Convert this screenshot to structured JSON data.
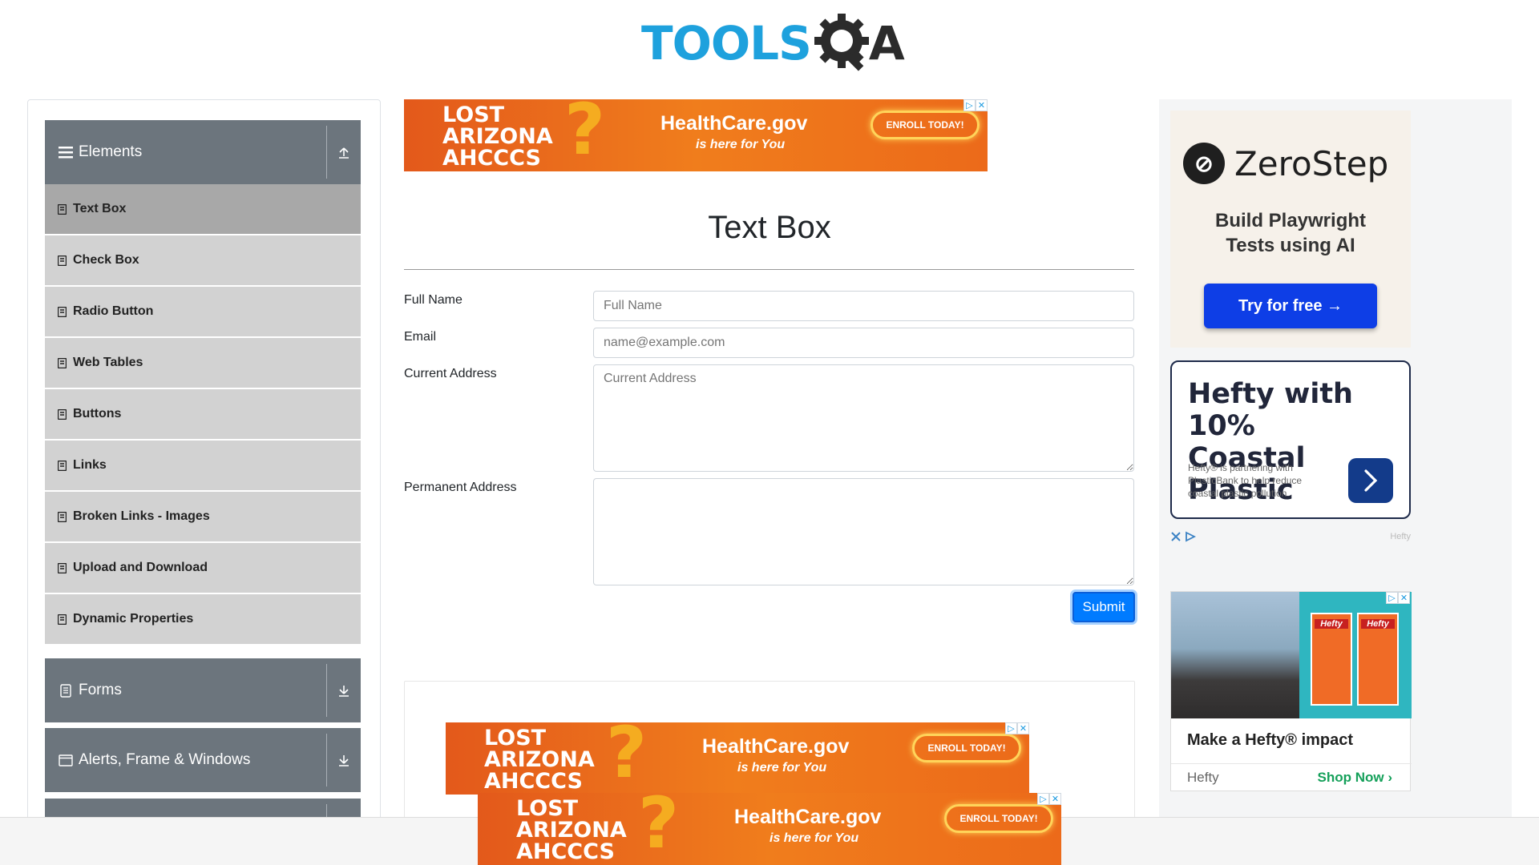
{
  "header": {
    "logo_part1": "TOOLS",
    "logo_part2": "A",
    "logo_alt": "ToolsQA"
  },
  "sidebar": {
    "groups": [
      {
        "label": "Elements",
        "icon": "hamburger-icon",
        "toggle_icon": "collapse-up-icon",
        "expanded": true
      },
      {
        "label": "Forms",
        "icon": "document-icon",
        "toggle_icon": "expand-down-icon",
        "expanded": false
      },
      {
        "label": "Alerts, Frame & Windows",
        "icon": "window-icon",
        "toggle_icon": "expand-down-icon",
        "expanded": false
      }
    ],
    "items": [
      {
        "label": "Text Box",
        "active": true
      },
      {
        "label": "Check Box",
        "active": false
      },
      {
        "label": "Radio Button",
        "active": false
      },
      {
        "label": "Web Tables",
        "active": false
      },
      {
        "label": "Buttons",
        "active": false
      },
      {
        "label": "Links",
        "active": false
      },
      {
        "label": "Broken Links - Images",
        "active": false
      },
      {
        "label": "Upload and Download",
        "active": false
      },
      {
        "label": "Dynamic Properties",
        "active": false
      }
    ]
  },
  "main": {
    "title": "Text Box",
    "form": {
      "full_name_label": "Full Name",
      "full_name_placeholder": "Full Name",
      "full_name_value": "",
      "email_label": "Email",
      "email_placeholder": "name@example.com",
      "email_value": "",
      "current_address_label": "Current Address",
      "current_address_placeholder": "Current Address",
      "current_address_value": "",
      "permanent_address_label": "Permanent Address",
      "permanent_address_value": "",
      "submit_label": "Submit"
    }
  },
  "ads": {
    "healthcare": {
      "line1": "LOST",
      "line2": "ARIZONA",
      "line3": "AHCCCS",
      "qmark": "?",
      "brand": "HealthCare.gov",
      "sub": "is here for You",
      "cta": "ENROLL TODAY!"
    },
    "zerostep": {
      "name": "ZeroStep",
      "tagline1": "Build Playwright",
      "tagline2": "Tests using AI",
      "cta": "Try for free →"
    },
    "hefty1": {
      "headline1": "Hefty with 10%",
      "headline2": "Coastal Plastic",
      "subtext": "Hefty® is partnering with PlasticBank to help reduce coastal plastic pollution",
      "footer_brand": "Hefty"
    },
    "hefty2": {
      "box_brand": "Hefty",
      "headline": "Make a Hefty® impact",
      "brand": "Hefty",
      "cta": "Shop Now"
    }
  },
  "colors": {
    "accent_blue": "#007bff",
    "sidebar_header": "#6c757d",
    "sidebar_item": "#d2d2d2",
    "sidebar_item_active": "#a8a8a8",
    "logo_blue": "#1ea1dd"
  }
}
